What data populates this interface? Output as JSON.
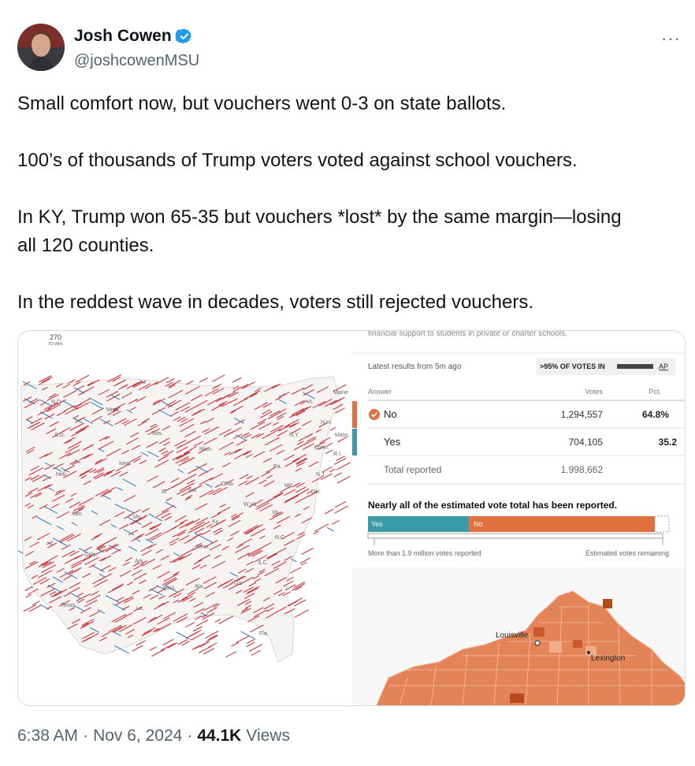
{
  "author": {
    "display_name": "Josh Cowen",
    "handle": "@joshcowenMSU",
    "verified_icon": "verified-badge-icon",
    "more_label": "···"
  },
  "tweet": {
    "paragraphs": [
      "Small comfort now, but vouchers went 0-3 on state ballots.",
      "100’s of thousands of Trump voters voted against school vouchers.",
      "In KY, Trump won 65-35 but vouchers *lost* by the same margin—losing all 120 counties.",
      "In the reddest wave in decades, voters still rejected vouchers."
    ]
  },
  "map": {
    "count_label": "270",
    "count_sub": "TO WIN",
    "states": [
      "N.D.",
      "Minn.",
      "S.D.",
      "Wis.",
      "Mich.",
      "Neb.",
      "Iowa",
      "Ill.",
      "Ind.",
      "Ohio",
      "Pa.",
      "N.Y.",
      "Vt.",
      "Maine",
      "N.H.",
      "Mass.",
      "Conn.",
      "R.I.",
      "N.J.",
      "Del.",
      "Md.",
      "W.Va.",
      "Va.",
      "Kan.",
      "Mo.",
      "Ky.",
      "N.C.",
      "Tenn.",
      "Okla.",
      "Ark.",
      "S.C.",
      "Miss.",
      "Ala.",
      "Ga.",
      "Texas",
      "La.",
      "Fla."
    ],
    "colors": {
      "republican_shift": "#c8343a",
      "democratic_shift": "#3b7fc4"
    }
  },
  "results": {
    "top_cut_text": "financial support to students in private or charter schools.",
    "latest": "Latest results from 5m ago",
    "pct_in": ">95% OF VOTES IN",
    "source": "AP",
    "headers": {
      "answer": "Answer",
      "votes": "Votes",
      "pct": "Pct."
    },
    "rows": [
      {
        "answer": "No",
        "votes": "1,294,557",
        "pct": "64.8%",
        "winner": true
      },
      {
        "answer": "Yes",
        "votes": "704,105",
        "pct": "35.2",
        "winner": false
      }
    ],
    "total_label": "Total reported",
    "total_votes": "1,998,662",
    "estimate_heading": "Nearly all of the estimated vote total has been reported.",
    "bar": {
      "yes_label": "Yes",
      "no_label": "No",
      "yes_share": 0.352,
      "no_share": 0.648
    },
    "reported_note": "More than 1.9 million votes reported",
    "remaining_note": "Estimated votes remaining",
    "colors": {
      "no": "#e2703f",
      "yes": "#3a9aa8"
    }
  },
  "ky_map": {
    "cities": [
      "Louisville",
      "Lexington"
    ],
    "fill": "#e28458"
  },
  "footer": {
    "time": "6:38 AM",
    "sep1": "·",
    "date": "Nov 6, 2024",
    "sep2": "·",
    "views_count": "44.1K",
    "views_label": "Views"
  }
}
